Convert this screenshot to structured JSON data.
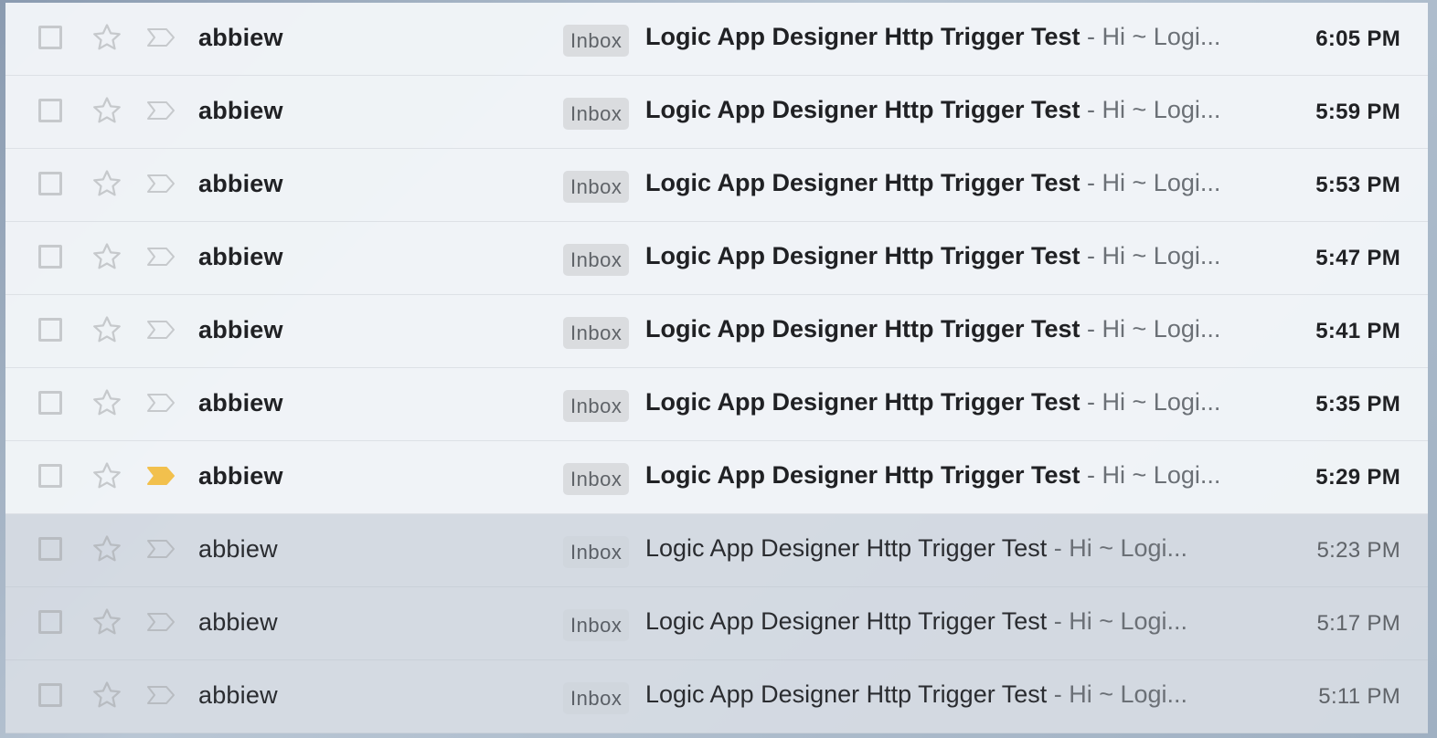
{
  "emails": [
    {
      "sender": "abbiew",
      "label": "Inbox",
      "subject": "Logic App Designer Http Trigger Test",
      "snippet": " - Hi ~ Logi...",
      "time": "6:05 PM",
      "unread": true,
      "important": false
    },
    {
      "sender": "abbiew",
      "label": "Inbox",
      "subject": "Logic App Designer Http Trigger Test",
      "snippet": " - Hi ~ Logi...",
      "time": "5:59 PM",
      "unread": true,
      "important": false
    },
    {
      "sender": "abbiew",
      "label": "Inbox",
      "subject": "Logic App Designer Http Trigger Test",
      "snippet": " - Hi ~ Logi...",
      "time": "5:53 PM",
      "unread": true,
      "important": false
    },
    {
      "sender": "abbiew",
      "label": "Inbox",
      "subject": "Logic App Designer Http Trigger Test",
      "snippet": " - Hi ~ Logi...",
      "time": "5:47 PM",
      "unread": true,
      "important": false
    },
    {
      "sender": "abbiew",
      "label": "Inbox",
      "subject": "Logic App Designer Http Trigger Test",
      "snippet": " - Hi ~ Logi...",
      "time": "5:41 PM",
      "unread": true,
      "important": false
    },
    {
      "sender": "abbiew",
      "label": "Inbox",
      "subject": "Logic App Designer Http Trigger Test",
      "snippet": " - Hi ~ Logi...",
      "time": "5:35 PM",
      "unread": true,
      "important": false
    },
    {
      "sender": "abbiew",
      "label": "Inbox",
      "subject": "Logic App Designer Http Trigger Test",
      "snippet": " - Hi ~ Logi...",
      "time": "5:29 PM",
      "unread": true,
      "important": true
    },
    {
      "sender": "abbiew",
      "label": "Inbox",
      "subject": "Logic App Designer Http Trigger Test",
      "snippet": " - Hi ~ Logi...",
      "time": "5:23 PM",
      "unread": false,
      "important": false
    },
    {
      "sender": "abbiew",
      "label": "Inbox",
      "subject": "Logic App Designer Http Trigger Test",
      "snippet": " - Hi ~ Logi...",
      "time": "5:17 PM",
      "unread": false,
      "important": false
    },
    {
      "sender": "abbiew",
      "label": "Inbox",
      "subject": "Logic App Designer Http Trigger Test",
      "snippet": " - Hi ~ Logi...",
      "time": "5:11 PM",
      "unread": false,
      "important": false
    }
  ],
  "icons": {
    "checkbox": "checkbox-icon",
    "star": "star-icon",
    "importance": "importance-marker-icon"
  },
  "colors": {
    "important_marker": "#F2C04D",
    "inactive_icon": "#C6C9CC"
  }
}
